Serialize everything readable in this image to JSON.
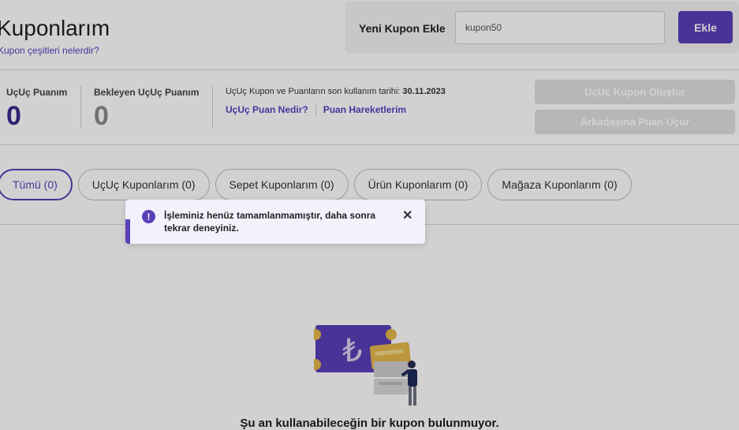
{
  "header": {
    "title": "Kuponlarım",
    "help_link": "Kupon çeşitleri nelerdir?",
    "add_label": "Yeni Kupon Ekle",
    "input_value": "kupon50",
    "add_button": "Ekle"
  },
  "stats": {
    "points_label": "UçUç Puanım",
    "points_value": "0",
    "pending_label": "Bekleyen UçUç Puanım",
    "pending_value": "0",
    "expiry_text": "UçUç Kupon ve Puanların son kullanım tarihi:",
    "expiry_date": "30.11.2023",
    "link_what": "UçUç Puan Nedir?",
    "link_history": "Puan Hareketlerim",
    "create_coupon_button": "UçUç Kupon Oluştur",
    "send_points_button": "Arkadaşına Puan Uçur"
  },
  "tabs": [
    {
      "label": "Tümü (0)"
    },
    {
      "label": "UçUç Kuponlarım (0)"
    },
    {
      "label": "Sepet Kuponlarım (0)"
    },
    {
      "label": "Ürün Kuponlarım (0)"
    },
    {
      "label": "Mağaza Kuponlarım (0)"
    }
  ],
  "toast": {
    "icon": "exclamation-icon",
    "message": "İşleminiz henüz tamamlanmamıştır, daha sonra tekrar deneyiniz.",
    "close": "✕"
  },
  "empty": {
    "message": "Şu an kullanabileceğin bir kupon bulunmuyor."
  },
  "colors": {
    "accent": "#5b3fb8",
    "points_value": "#3a2a8c",
    "pending_value": "#8a8a8a"
  }
}
